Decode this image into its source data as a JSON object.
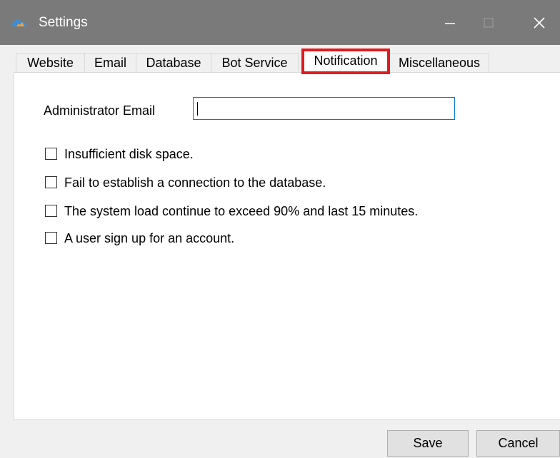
{
  "window": {
    "title": "Settings",
    "icon": "cloud-app-icon",
    "controls": [
      "minimize-icon",
      "maximize-icon",
      "close-icon"
    ]
  },
  "tabs": [
    {
      "label": "Website",
      "active": false
    },
    {
      "label": "Email",
      "active": false
    },
    {
      "label": "Database",
      "active": false
    },
    {
      "label": "Bot Service",
      "active": false
    },
    {
      "label": "Notification",
      "active": true
    },
    {
      "label": "Miscellaneous",
      "active": false
    }
  ],
  "notification": {
    "admin_email_label": "Administrator Email",
    "admin_email_value": "",
    "options": [
      {
        "label": "Insufficient disk space.",
        "checked": false
      },
      {
        "label": "Fail to establish a connection to the database.",
        "checked": false
      },
      {
        "label": "The system load continue to exceed 90% and last 15 minutes.",
        "checked": false
      },
      {
        "label": "A user sign up for an account.",
        "checked": false
      }
    ]
  },
  "buttons": {
    "save": "Save",
    "cancel": "Cancel"
  },
  "colors": {
    "titlebar": "#7a7a7a",
    "highlight": "#e31920",
    "input_focus": "#0078d7"
  }
}
